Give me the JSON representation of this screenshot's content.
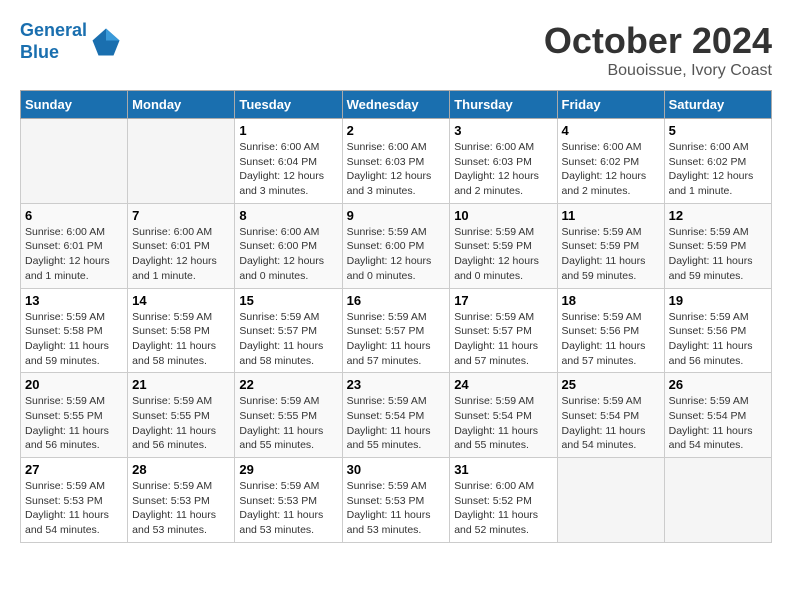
{
  "header": {
    "logo_line1": "General",
    "logo_line2": "Blue",
    "month": "October 2024",
    "location": "Bouoissue, Ivory Coast"
  },
  "weekdays": [
    "Sunday",
    "Monday",
    "Tuesday",
    "Wednesday",
    "Thursday",
    "Friday",
    "Saturday"
  ],
  "weeks": [
    [
      {
        "day": "",
        "info": ""
      },
      {
        "day": "",
        "info": ""
      },
      {
        "day": "1",
        "info": "Sunrise: 6:00 AM\nSunset: 6:04 PM\nDaylight: 12 hours\nand 3 minutes."
      },
      {
        "day": "2",
        "info": "Sunrise: 6:00 AM\nSunset: 6:03 PM\nDaylight: 12 hours\nand 3 minutes."
      },
      {
        "day": "3",
        "info": "Sunrise: 6:00 AM\nSunset: 6:03 PM\nDaylight: 12 hours\nand 2 minutes."
      },
      {
        "day": "4",
        "info": "Sunrise: 6:00 AM\nSunset: 6:02 PM\nDaylight: 12 hours\nand 2 minutes."
      },
      {
        "day": "5",
        "info": "Sunrise: 6:00 AM\nSunset: 6:02 PM\nDaylight: 12 hours\nand 1 minute."
      }
    ],
    [
      {
        "day": "6",
        "info": "Sunrise: 6:00 AM\nSunset: 6:01 PM\nDaylight: 12 hours\nand 1 minute."
      },
      {
        "day": "7",
        "info": "Sunrise: 6:00 AM\nSunset: 6:01 PM\nDaylight: 12 hours\nand 1 minute."
      },
      {
        "day": "8",
        "info": "Sunrise: 6:00 AM\nSunset: 6:00 PM\nDaylight: 12 hours\nand 0 minutes."
      },
      {
        "day": "9",
        "info": "Sunrise: 5:59 AM\nSunset: 6:00 PM\nDaylight: 12 hours\nand 0 minutes."
      },
      {
        "day": "10",
        "info": "Sunrise: 5:59 AM\nSunset: 5:59 PM\nDaylight: 12 hours\nand 0 minutes."
      },
      {
        "day": "11",
        "info": "Sunrise: 5:59 AM\nSunset: 5:59 PM\nDaylight: 11 hours\nand 59 minutes."
      },
      {
        "day": "12",
        "info": "Sunrise: 5:59 AM\nSunset: 5:59 PM\nDaylight: 11 hours\nand 59 minutes."
      }
    ],
    [
      {
        "day": "13",
        "info": "Sunrise: 5:59 AM\nSunset: 5:58 PM\nDaylight: 11 hours\nand 59 minutes."
      },
      {
        "day": "14",
        "info": "Sunrise: 5:59 AM\nSunset: 5:58 PM\nDaylight: 11 hours\nand 58 minutes."
      },
      {
        "day": "15",
        "info": "Sunrise: 5:59 AM\nSunset: 5:57 PM\nDaylight: 11 hours\nand 58 minutes."
      },
      {
        "day": "16",
        "info": "Sunrise: 5:59 AM\nSunset: 5:57 PM\nDaylight: 11 hours\nand 57 minutes."
      },
      {
        "day": "17",
        "info": "Sunrise: 5:59 AM\nSunset: 5:57 PM\nDaylight: 11 hours\nand 57 minutes."
      },
      {
        "day": "18",
        "info": "Sunrise: 5:59 AM\nSunset: 5:56 PM\nDaylight: 11 hours\nand 57 minutes."
      },
      {
        "day": "19",
        "info": "Sunrise: 5:59 AM\nSunset: 5:56 PM\nDaylight: 11 hours\nand 56 minutes."
      }
    ],
    [
      {
        "day": "20",
        "info": "Sunrise: 5:59 AM\nSunset: 5:55 PM\nDaylight: 11 hours\nand 56 minutes."
      },
      {
        "day": "21",
        "info": "Sunrise: 5:59 AM\nSunset: 5:55 PM\nDaylight: 11 hours\nand 56 minutes."
      },
      {
        "day": "22",
        "info": "Sunrise: 5:59 AM\nSunset: 5:55 PM\nDaylight: 11 hours\nand 55 minutes."
      },
      {
        "day": "23",
        "info": "Sunrise: 5:59 AM\nSunset: 5:54 PM\nDaylight: 11 hours\nand 55 minutes."
      },
      {
        "day": "24",
        "info": "Sunrise: 5:59 AM\nSunset: 5:54 PM\nDaylight: 11 hours\nand 55 minutes."
      },
      {
        "day": "25",
        "info": "Sunrise: 5:59 AM\nSunset: 5:54 PM\nDaylight: 11 hours\nand 54 minutes."
      },
      {
        "day": "26",
        "info": "Sunrise: 5:59 AM\nSunset: 5:54 PM\nDaylight: 11 hours\nand 54 minutes."
      }
    ],
    [
      {
        "day": "27",
        "info": "Sunrise: 5:59 AM\nSunset: 5:53 PM\nDaylight: 11 hours\nand 54 minutes."
      },
      {
        "day": "28",
        "info": "Sunrise: 5:59 AM\nSunset: 5:53 PM\nDaylight: 11 hours\nand 53 minutes."
      },
      {
        "day": "29",
        "info": "Sunrise: 5:59 AM\nSunset: 5:53 PM\nDaylight: 11 hours\nand 53 minutes."
      },
      {
        "day": "30",
        "info": "Sunrise: 5:59 AM\nSunset: 5:53 PM\nDaylight: 11 hours\nand 53 minutes."
      },
      {
        "day": "31",
        "info": "Sunrise: 6:00 AM\nSunset: 5:52 PM\nDaylight: 11 hours\nand 52 minutes."
      },
      {
        "day": "",
        "info": ""
      },
      {
        "day": "",
        "info": ""
      }
    ]
  ]
}
